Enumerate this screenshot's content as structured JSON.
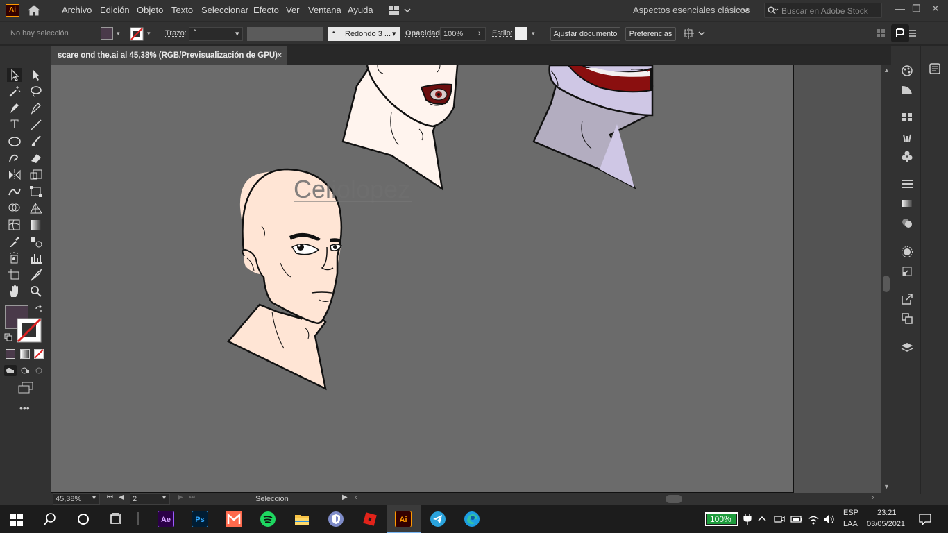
{
  "app": {
    "logo": "Ai"
  },
  "menu": [
    "Archivo",
    "Edición",
    "Objeto",
    "Texto",
    "Seleccionar",
    "Efecto",
    "Ver",
    "Ventana",
    "Ayuda"
  ],
  "workspace": {
    "label": "Aspectos esenciales clásicos"
  },
  "search": {
    "placeholder": "Buscar en Adobe Stock"
  },
  "control": {
    "selection": "No hay selección",
    "stroke_label": "Trazo:",
    "brush": "Redondo 3 ...",
    "opacity_label": "Opacidad:",
    "opacity": "100%",
    "style_label": "Estilo:",
    "fit_button": "Ajustar documento",
    "prefs_button": "Preferencias",
    "fill_color": "#4a3a4a"
  },
  "tab": {
    "title": "scare ond the.ai al 45,38% (RGB/Previsualización de GPU)",
    "close": "×"
  },
  "canvas": {
    "watermark": "Celiolopez"
  },
  "status": {
    "zoom": "45,38%",
    "artboard": "2",
    "tool": "Selección"
  },
  "taskbar": {
    "battery": "100%",
    "lang1": "ESP",
    "lang2": "LAA",
    "time": "23:21",
    "date": "03/05/2021"
  }
}
